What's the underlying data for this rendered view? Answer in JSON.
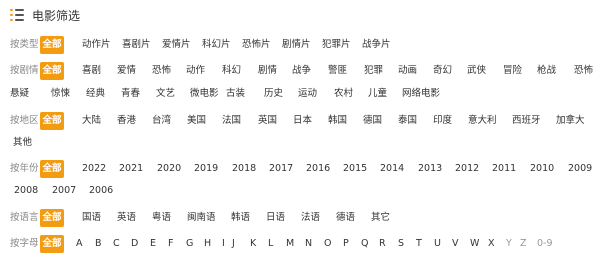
{
  "header": {
    "title": "电影筛选"
  },
  "rows": [
    {
      "label": "按类型",
      "options": [
        "全部",
        "动作片",
        "喜剧片",
        "爱情片",
        "科幻片",
        "恐怖片",
        "剧情片",
        "犯罪片",
        "战争片"
      ]
    },
    {
      "label": "按剧情",
      "options": [
        "全部",
        "喜剧",
        "爱情",
        "恐怖",
        "动作",
        "科幻",
        "剧情",
        "战争",
        "警匪",
        "犯罪",
        "动画",
        "奇幻",
        "武侠",
        "冒险",
        "枪战",
        "恐怖",
        "悬疑",
        "惊悚",
        "经典",
        "青春",
        "文艺",
        "微电影",
        "古装",
        "历史",
        "运动",
        "农村",
        "儿童",
        "网络电影"
      ]
    },
    {
      "label": "按地区",
      "options": [
        "全部",
        "大陆",
        "香港",
        "台湾",
        "美国",
        "法国",
        "英国",
        "日本",
        "韩国",
        "德国",
        "泰国",
        "印度",
        "意大利",
        "西班牙",
        "加拿大",
        "其他"
      ]
    },
    {
      "label": "按年份",
      "options": [
        "全部",
        "2022",
        "2021",
        "2020",
        "2019",
        "2018",
        "2017",
        "2016",
        "2015",
        "2014",
        "2013",
        "2012",
        "2011",
        "2010",
        "2009",
        "2008",
        "2007",
        "2006"
      ]
    },
    {
      "label": "按语言",
      "options": [
        "全部",
        "国语",
        "英语",
        "粤语",
        "闽南语",
        "韩语",
        "日语",
        "法语",
        "德语",
        "其它"
      ]
    },
    {
      "label": "按字母",
      "options": [
        "全部",
        "A",
        "B",
        "C",
        "D",
        "E",
        "F",
        "G",
        "H",
        "I",
        "J",
        "K",
        "L",
        "M",
        "N",
        "O",
        "P",
        "Q",
        "R",
        "S",
        "T",
        "U",
        "V",
        "W",
        "X",
        "Y",
        "Z",
        "0-9"
      ]
    }
  ]
}
